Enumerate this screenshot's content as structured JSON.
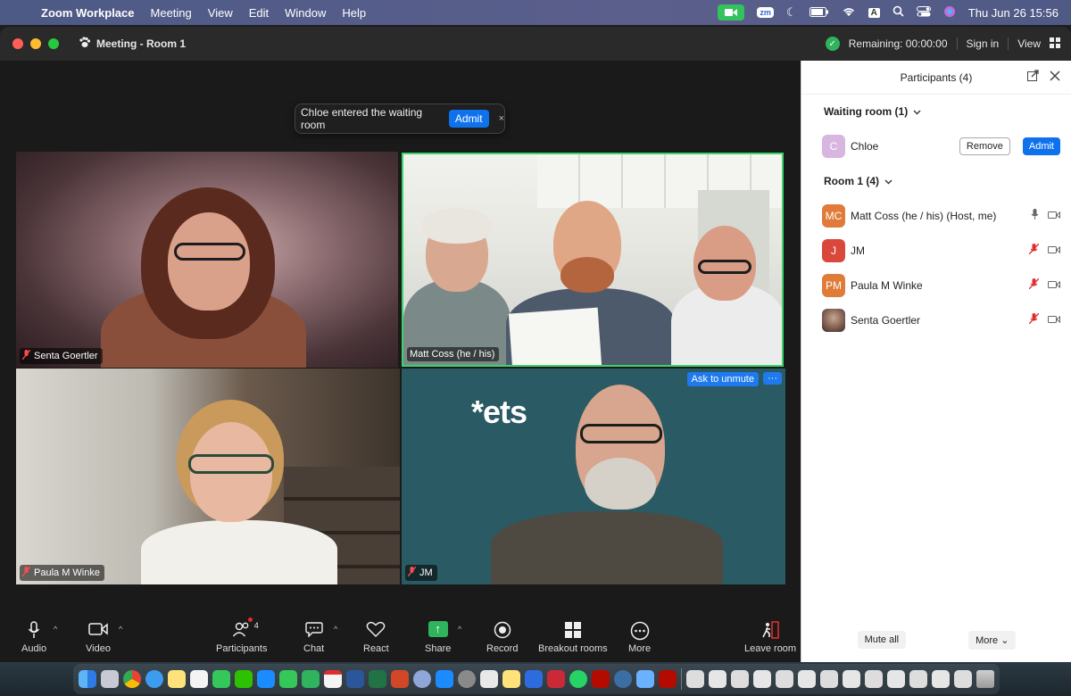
{
  "menubar": {
    "app_name": "Zoom Workplace",
    "items": [
      "Meeting",
      "View",
      "Edit",
      "Window",
      "Help"
    ],
    "status_zm": "zm",
    "status_a": "A",
    "clock": "Thu Jun 26  15:56"
  },
  "window": {
    "title": "Meeting - Room 1",
    "remaining": "Remaining: 00:00:00",
    "sign_in": "Sign in",
    "view": "View"
  },
  "notification": {
    "text": "Chloe entered the waiting room",
    "admit_label": "Admit",
    "close_glyph": "×"
  },
  "tiles": {
    "senta": "Senta Goertler",
    "matt": "Matt Coss (he / his)",
    "paula": "Paula M Winke",
    "jm": "JM",
    "jm_logo": "*ets",
    "ask_to_unmute": "Ask to unmute",
    "more_glyph": "···"
  },
  "panel": {
    "title": "Participants (4)",
    "waiting_title": "Waiting room (1)",
    "waiting": [
      {
        "initials": "C",
        "name": "Chloe",
        "remove_label": "Remove",
        "admit_label": "Admit"
      }
    ],
    "room_title": "Room 1 (4)",
    "participants": [
      {
        "initials": "MC",
        "name": "Matt Coss (he / his) (Host, me)"
      },
      {
        "initials": "J",
        "name": "JM"
      },
      {
        "initials": "PM",
        "name": "Paula M Winke"
      },
      {
        "initials": "",
        "name": "Senta Goertler"
      }
    ],
    "mute_all": "Mute all",
    "more": "More"
  },
  "toolbar": {
    "audio": "Audio",
    "video": "Video",
    "participants": "Participants",
    "participants_count": "4",
    "chat": "Chat",
    "react": "React",
    "share": "Share",
    "record": "Record",
    "breakout": "Breakout rooms",
    "more": "More",
    "leave": "Leave room"
  },
  "colors": {
    "accent_blue": "#0e72ed",
    "active_speaker_green": "#3bd46b",
    "mute_red": "#e02e2e"
  }
}
